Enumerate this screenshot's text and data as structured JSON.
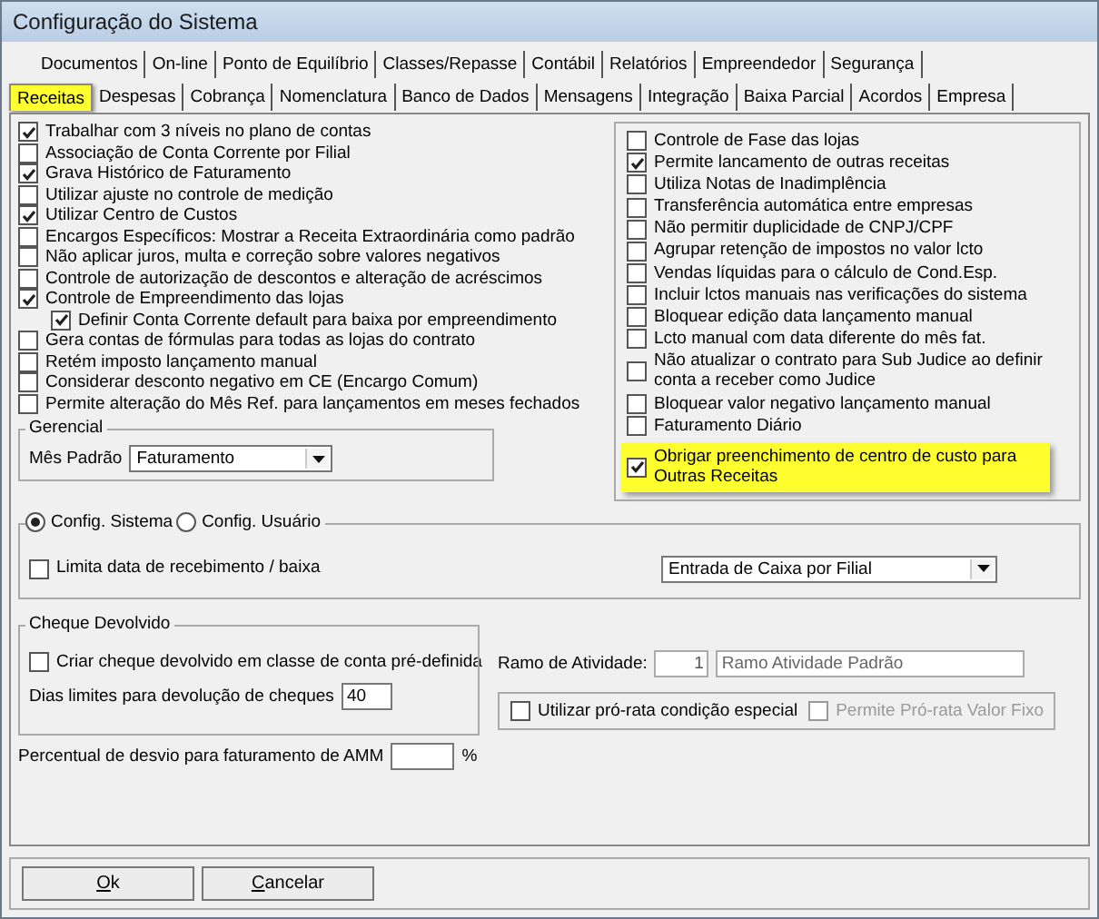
{
  "window": {
    "title": "Configuração do Sistema"
  },
  "tab_rows": [
    {
      "tabs": [
        {
          "label": "Documentos",
          "selected": false,
          "highlighted": false
        },
        {
          "label": "On-line",
          "selected": false,
          "highlighted": false
        },
        {
          "label": "Ponto de Equilíbrio",
          "selected": false,
          "highlighted": false
        },
        {
          "label": "Classes/Repasse",
          "selected": false,
          "highlighted": false
        },
        {
          "label": "Contábil",
          "selected": false,
          "highlighted": false
        },
        {
          "label": "Relatórios",
          "selected": false,
          "highlighted": false
        },
        {
          "label": "Empreendedor",
          "selected": false,
          "highlighted": false
        },
        {
          "label": "Segurança",
          "selected": false,
          "highlighted": false
        }
      ]
    },
    {
      "tabs": [
        {
          "label": "Receitas",
          "selected": true,
          "highlighted": true
        },
        {
          "label": "Despesas",
          "selected": false,
          "highlighted": false
        },
        {
          "label": "Cobrança",
          "selected": false,
          "highlighted": false
        },
        {
          "label": "Nomenclatura",
          "selected": false,
          "highlighted": false
        },
        {
          "label": "Banco de Dados",
          "selected": false,
          "highlighted": false
        },
        {
          "label": "Mensagens",
          "selected": false,
          "highlighted": false
        },
        {
          "label": "Integração",
          "selected": false,
          "highlighted": false
        },
        {
          "label": "Baixa Parcial",
          "selected": false,
          "highlighted": false
        },
        {
          "label": "Acordos",
          "selected": false,
          "highlighted": false
        },
        {
          "label": "Empresa",
          "selected": false,
          "highlighted": false
        }
      ]
    }
  ],
  "left_options": [
    {
      "label": "Trabalhar com 3 níveis no plano de contas",
      "checked": true
    },
    {
      "label": "Associação de Conta Corrente por Filial",
      "checked": false
    },
    {
      "label": "Grava Histórico de Faturamento",
      "checked": true
    },
    {
      "label": "Utilizar ajuste no controle de medição",
      "checked": false
    },
    {
      "label": "Utilizar Centro de Custos",
      "checked": true
    },
    {
      "label": "Encargos Específicos: Mostrar a Receita Extraordinária como padrão",
      "checked": false
    },
    {
      "label": "Não aplicar juros, multa e correção sobre valores negativos",
      "checked": false
    },
    {
      "label": "Controle de autorização de descontos e alteração de acréscimos",
      "checked": false
    },
    {
      "label": "Controle de Empreendimento das lojas",
      "checked": true,
      "children": [
        {
          "label": "Definir Conta Corrente default para baixa por empreendimento",
          "checked": true
        }
      ]
    },
    {
      "label": "Gera contas de fórmulas para todas as lojas do contrato",
      "checked": false
    },
    {
      "label": "Retém imposto lançamento manual",
      "checked": false
    },
    {
      "label": "Considerar desconto negativo em CE (Encargo Comum)",
      "checked": false
    },
    {
      "label": "Permite alteração do Mês Ref. para lançamentos em meses fechados",
      "checked": false
    }
  ],
  "gerencial": {
    "title": "Gerencial",
    "label": "Mês Padrão",
    "value": "Faturamento"
  },
  "right_options": [
    {
      "label": "Controle de Fase das lojas",
      "checked": false,
      "highlighted": false
    },
    {
      "label": "Permite lancamento de outras receitas",
      "checked": true,
      "highlighted": false
    },
    {
      "label": "Utiliza Notas de Inadimplência",
      "checked": false,
      "highlighted": false
    },
    {
      "label": "Transferência automática entre empresas",
      "checked": false,
      "highlighted": false
    },
    {
      "label": "Não permitir duplicidade de CNPJ/CPF",
      "checked": false,
      "highlighted": false
    },
    {
      "label": "Agrupar retenção de impostos no valor lcto",
      "checked": false,
      "highlighted": false
    },
    {
      "label": "Vendas líquidas para o cálculo de Cond.Esp.",
      "checked": false,
      "highlighted": false
    },
    {
      "label": "Incluir lctos manuais nas verificações do sistema",
      "checked": false,
      "highlighted": false
    },
    {
      "label": "Bloquear edição data lançamento manual",
      "checked": false,
      "highlighted": false
    },
    {
      "label": "Lcto manual com data diferente do mês fat.",
      "checked": false,
      "highlighted": false
    },
    {
      "label": "Não atualizar o contrato para Sub Judice ao definir conta a receber como Judice",
      "checked": false,
      "highlighted": false
    },
    {
      "label": "Bloquear valor negativo lançamento manual",
      "checked": false,
      "highlighted": false
    },
    {
      "label": "Faturamento Diário",
      "checked": false,
      "highlighted": false
    },
    {
      "label": "Obrigar preenchimento de centro de custo para Outras Receitas",
      "checked": true,
      "highlighted": true
    }
  ],
  "config_group": {
    "radios": [
      {
        "label": "Config. Sistema",
        "selected": true
      },
      {
        "label": "Config. Usuário",
        "selected": false
      }
    ],
    "option": {
      "label": "Limita data de recebimento / baixa",
      "checked": false
    },
    "dropdown": {
      "value": "Entrada de Caixa por Filial"
    }
  },
  "cheque_devolvido": {
    "title": "Cheque Devolvido",
    "option": {
      "label": "Criar cheque devolvido em classe de conta pré-definida",
      "checked": false
    },
    "days_label": "Dias limites para devolução de cheques",
    "days_value": "40"
  },
  "ramo": {
    "label": "Ramo de Atividade:",
    "code": "1",
    "name": "Ramo Atividade Padrão"
  },
  "pro_rata": [
    {
      "label": "Utilizar pró-rata condição especial",
      "checked": false,
      "disabled": false
    },
    {
      "label": "Permite Pró-rata Valor Fixo",
      "checked": false,
      "disabled": true
    }
  ],
  "percentual": {
    "label": "Percentual de desvio para faturamento de AMM",
    "unit": "%"
  },
  "buttons": [
    {
      "label": "Ok",
      "first_letter_underlined": true
    },
    {
      "label": "Cancelar",
      "first_letter_underlined": true
    }
  ]
}
